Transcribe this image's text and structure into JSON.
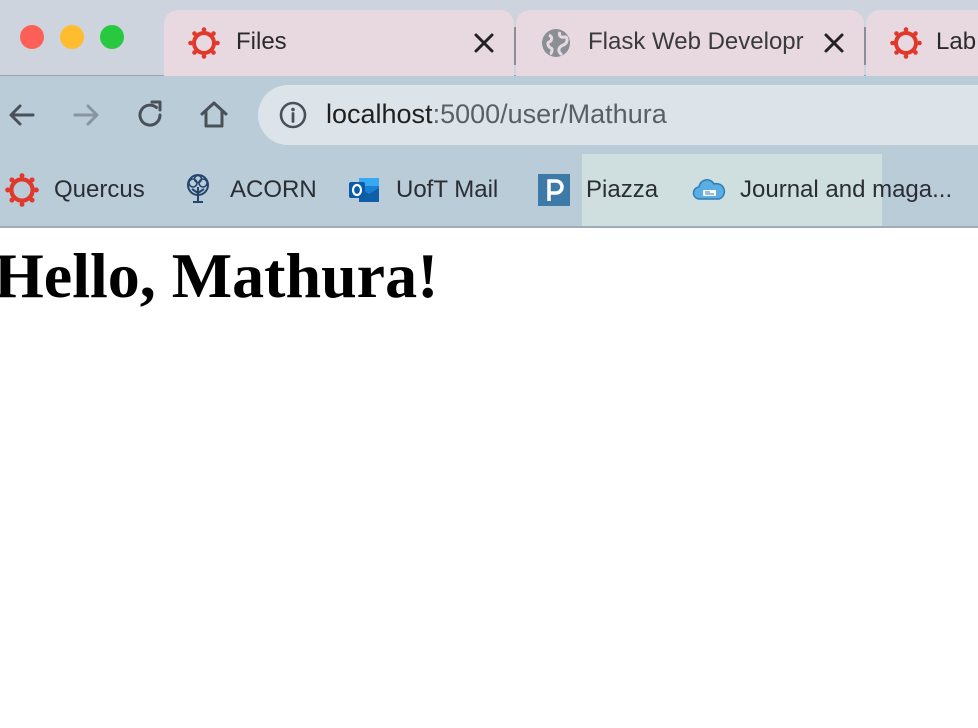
{
  "window": {
    "traffic_lights": {
      "close_color": "#fe5f57",
      "minimize_color": "#febc2e",
      "maximize_color": "#28c840"
    }
  },
  "tabs": [
    {
      "title": "Files",
      "icon": "canvas-icon",
      "active": true
    },
    {
      "title": "Flask Web Developr",
      "icon": "globe-icon",
      "active": false
    },
    {
      "title": "Lab",
      "icon": "canvas-icon",
      "active": false
    }
  ],
  "toolbar": {
    "back_icon": "arrow-left-icon",
    "forward_icon": "arrow-right-icon",
    "reload_icon": "reload-icon",
    "home_icon": "home-icon"
  },
  "address_bar": {
    "icon": "info-icon",
    "host": "localhost",
    "path": ":5000/user/Mathura"
  },
  "bookmarks": [
    {
      "label": "Quercus",
      "icon": "canvas-icon"
    },
    {
      "label": "ACORN",
      "icon": "tree-icon"
    },
    {
      "label": "UofT Mail",
      "icon": "outlook-icon"
    },
    {
      "label": "Piazza",
      "icon": "piazza-icon"
    },
    {
      "label": "Journal and maga...",
      "icon": "cloud-icon"
    }
  ],
  "page": {
    "heading": "Hello, Mathura!"
  },
  "colors": {
    "tab_active_bg": "#e8d9e0",
    "tabstrip_bg": "#cdd4de",
    "toolbar_bg": "#b9ccd8",
    "omnibox_bg": "#dce4ea",
    "canvas_red": "#e0392b"
  }
}
